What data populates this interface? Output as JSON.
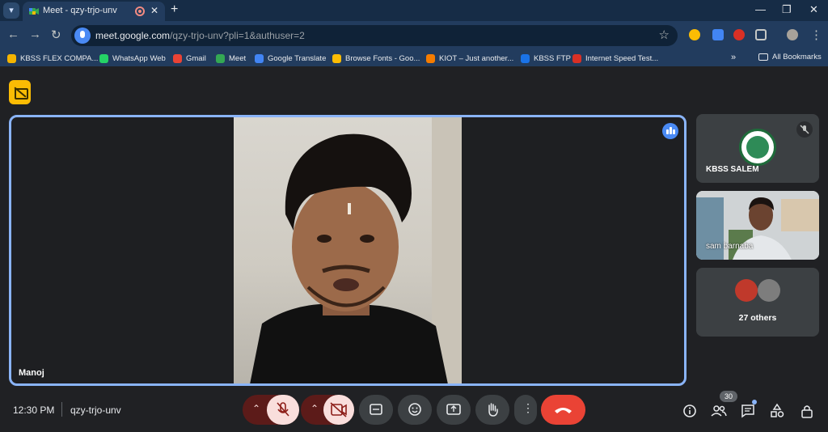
{
  "browser": {
    "tab_title": "Meet - qzy-trjo-unv",
    "url_host": "meet.google.com",
    "url_path": "/qzy-trjo-unv?pli=1&authuser=2",
    "bookmarks": [
      {
        "label": "KBSS FLEX COMPA...",
        "color": "#f4b400"
      },
      {
        "label": "WhatsApp Web",
        "color": "#25d366"
      },
      {
        "label": "Gmail",
        "color": "#ea4335"
      },
      {
        "label": "Meet",
        "color": "#34a853"
      },
      {
        "label": "Google Translate",
        "color": "#4285f4"
      },
      {
        "label": "Browse Fonts - Goo...",
        "color": "#fbbc04"
      },
      {
        "label": "KIOT – Just another...",
        "color": "#f57c00"
      },
      {
        "label": "KBSS FTP",
        "color": "#1a73e8"
      },
      {
        "label": "Internet Speed Test...",
        "color": "#d93025"
      }
    ],
    "all_bookmarks": "All Bookmarks",
    "more": "»"
  },
  "meet": {
    "main_participant": "Manoj",
    "tiles": [
      {
        "name": "KBSS SALEM"
      },
      {
        "name": "sam barnaba"
      },
      {
        "name": "27 others"
      }
    ],
    "time": "12:30 PM",
    "meeting_code": "qzy-trjo-unv",
    "participants_count": "30"
  },
  "colors": {
    "accent": "#8ab4f8",
    "end_call": "#ea4335",
    "caption_badge": "#fbbc04"
  }
}
